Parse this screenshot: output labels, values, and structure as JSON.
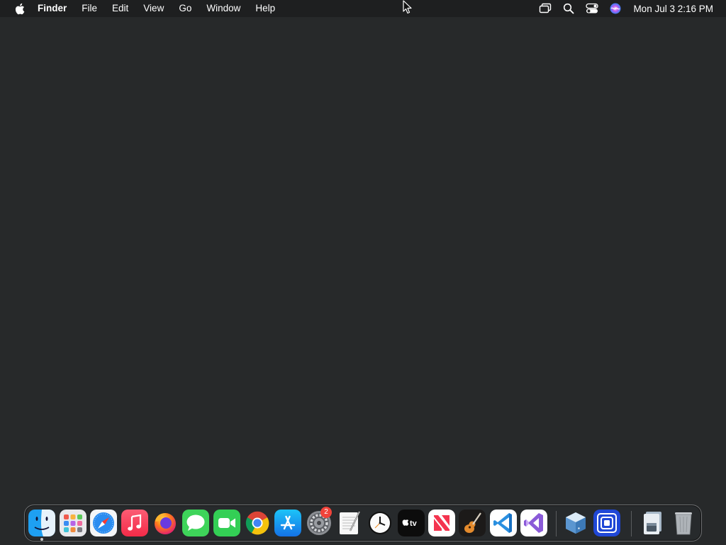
{
  "menubar": {
    "app_name": "Finder",
    "items": [
      "File",
      "Edit",
      "View",
      "Go",
      "Window",
      "Help"
    ],
    "clock": "Mon Jul 3  2:16 PM",
    "status_icons": [
      "screen-mirroring-icon",
      "spotlight-search-icon",
      "control-center-icon",
      "siri-icon"
    ]
  },
  "dock": {
    "apps": [
      {
        "name": "finder",
        "icon": "finder-icon",
        "running": true
      },
      {
        "name": "launchpad",
        "icon": "launchpad-icon",
        "running": false
      },
      {
        "name": "safari",
        "icon": "safari-icon",
        "running": false
      },
      {
        "name": "music",
        "icon": "music-icon",
        "running": false
      },
      {
        "name": "firefox",
        "icon": "firefox-icon",
        "running": false
      },
      {
        "name": "messages",
        "icon": "messages-icon",
        "running": false
      },
      {
        "name": "facetime",
        "icon": "facetime-icon",
        "running": false
      },
      {
        "name": "chrome",
        "icon": "chrome-icon",
        "running": false
      },
      {
        "name": "app-store",
        "icon": "app-store-icon",
        "running": false
      },
      {
        "name": "system-settings",
        "icon": "system-settings-icon",
        "running": false,
        "badge": "2"
      },
      {
        "name": "textedit",
        "icon": "textedit-icon",
        "running": false
      },
      {
        "name": "clock",
        "icon": "clock-icon",
        "running": false
      },
      {
        "name": "apple-tv",
        "icon": "apple-tv-icon",
        "running": false,
        "label": "tv"
      },
      {
        "name": "news",
        "icon": "news-icon",
        "running": false
      },
      {
        "name": "garageband",
        "icon": "garageband-icon",
        "running": false
      },
      {
        "name": "vscode",
        "icon": "vscode-icon",
        "running": false
      },
      {
        "name": "visual-studio",
        "icon": "visual-studio-icon",
        "running": false
      },
      {
        "name": "virtualbox",
        "icon": "virtualbox-icon",
        "running": false
      },
      {
        "name": "frame-app",
        "icon": "frame-app-icon",
        "running": false
      },
      {
        "name": "downloads-stack",
        "icon": "downloads-stack-icon",
        "running": false
      },
      {
        "name": "trash",
        "icon": "trash-icon",
        "running": false
      }
    ]
  },
  "colors": {
    "desktop": "#27292a",
    "menubar": "#1e1f20",
    "badge": "#f0433a"
  }
}
